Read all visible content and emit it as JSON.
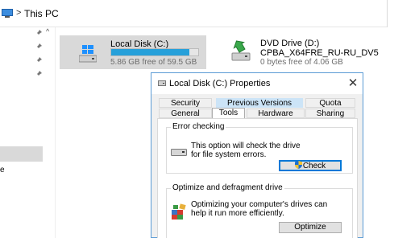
{
  "explorer": {
    "breadcrumb": {
      "separator": ">",
      "location": "This PC"
    },
    "nav": {
      "truncated_label": "e"
    },
    "drives": [
      {
        "name": "Local Disk (C:)",
        "free_text": "5.86 GB free of 59.5 GB",
        "used_fraction": 0.9
      },
      {
        "name": "DVD Drive (D:)",
        "volume_label": "CPBA_X64FRE_RU-RU_DV5",
        "free_text": "0 bytes free of 4.06 GB"
      }
    ]
  },
  "dialog": {
    "title": "Local Disk (C:) Properties",
    "close_glyph": "✕",
    "tabs_row1": [
      "Security",
      "Previous Versions",
      "Quota"
    ],
    "tabs_row2": [
      "General",
      "Tools",
      "Hardware",
      "Sharing"
    ],
    "active_tab": "Tools",
    "error_checking": {
      "legend": "Error checking",
      "description": "This option will check the drive for file system errors.",
      "button": "Check"
    },
    "optimize": {
      "legend": "Optimize and defragment drive",
      "description": "Optimizing your computer's drives can help it run more efficiently.",
      "button": "Optimize"
    }
  },
  "colors": {
    "accent": "#0078d7",
    "progress_fill": "#26a0da",
    "selection": "#d9d9d9",
    "tab_highlight": "#cce4f7"
  }
}
